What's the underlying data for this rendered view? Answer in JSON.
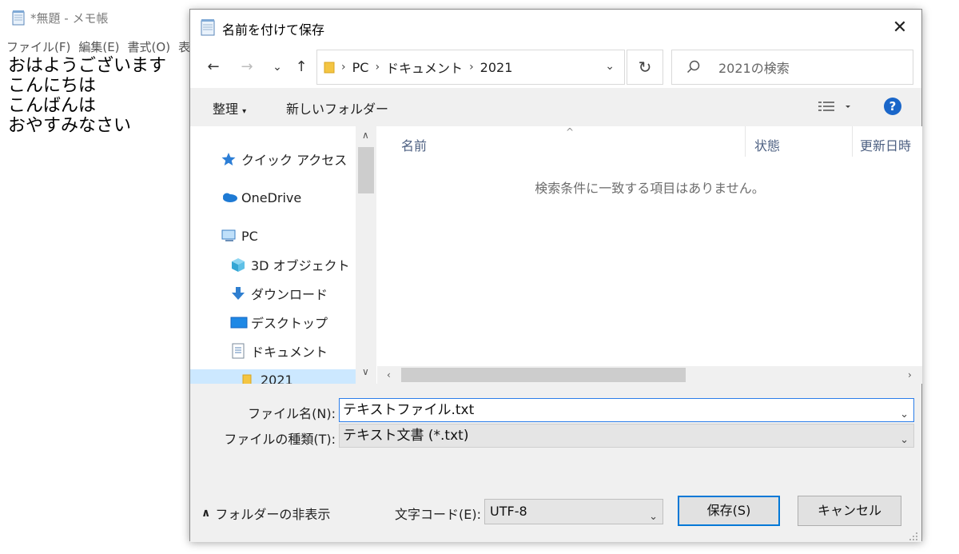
{
  "notepad": {
    "title": "*無題 - メモ帳",
    "menu": [
      "ファイル(F)",
      "編集(E)",
      "書式(O)",
      "表"
    ],
    "text": "おはようございます\nこんにちは\nこんばんは\nおやすみなさい"
  },
  "dialog": {
    "title": "名前を付けて保存",
    "close_icon": "close-icon",
    "nav": {
      "back": "←",
      "forward": "→",
      "recent": "⌄",
      "up": "↑",
      "breadcrumb": [
        "PC",
        "ドキュメント",
        "2021"
      ],
      "refresh": "↻",
      "search_placeholder": "2021の検索"
    },
    "toolbar": {
      "organize": "整理",
      "new_folder": "新しいフォルダー",
      "help": "?"
    },
    "nav_pane": [
      {
        "label": "クイック アクセス",
        "icon": "star-icon"
      },
      {
        "label": "OneDrive",
        "icon": "cloud-icon"
      },
      {
        "label": "PC",
        "icon": "computer-icon"
      },
      {
        "label": "3D オブジェクト",
        "icon": "cube-icon"
      },
      {
        "label": "ダウンロード",
        "icon": "download-icon"
      },
      {
        "label": "デスクトップ",
        "icon": "desktop-icon"
      },
      {
        "label": "ドキュメント",
        "icon": "document-icon"
      },
      {
        "label": "2021",
        "icon": "folder-icon",
        "selected": true
      }
    ],
    "columns": [
      "名前",
      "状態",
      "更新日時"
    ],
    "empty_message": "検索条件に一致する項目はありません。",
    "form": {
      "filename_label": "ファイル名(N):",
      "filename_value": "テキストファイル.txt",
      "filetype_label": "ファイルの種類(T):",
      "filetype_value": "テキスト文書 (*.txt)",
      "encoding_label": "文字コード(E):",
      "encoding_value": "UTF-8",
      "save": "保存(S)",
      "cancel": "キャンセル",
      "hide_folders": "フォルダーの非表示"
    },
    "colors": {
      "accent": "#0078d7",
      "selection": "#cce8ff",
      "help": "#1a66c9"
    }
  }
}
